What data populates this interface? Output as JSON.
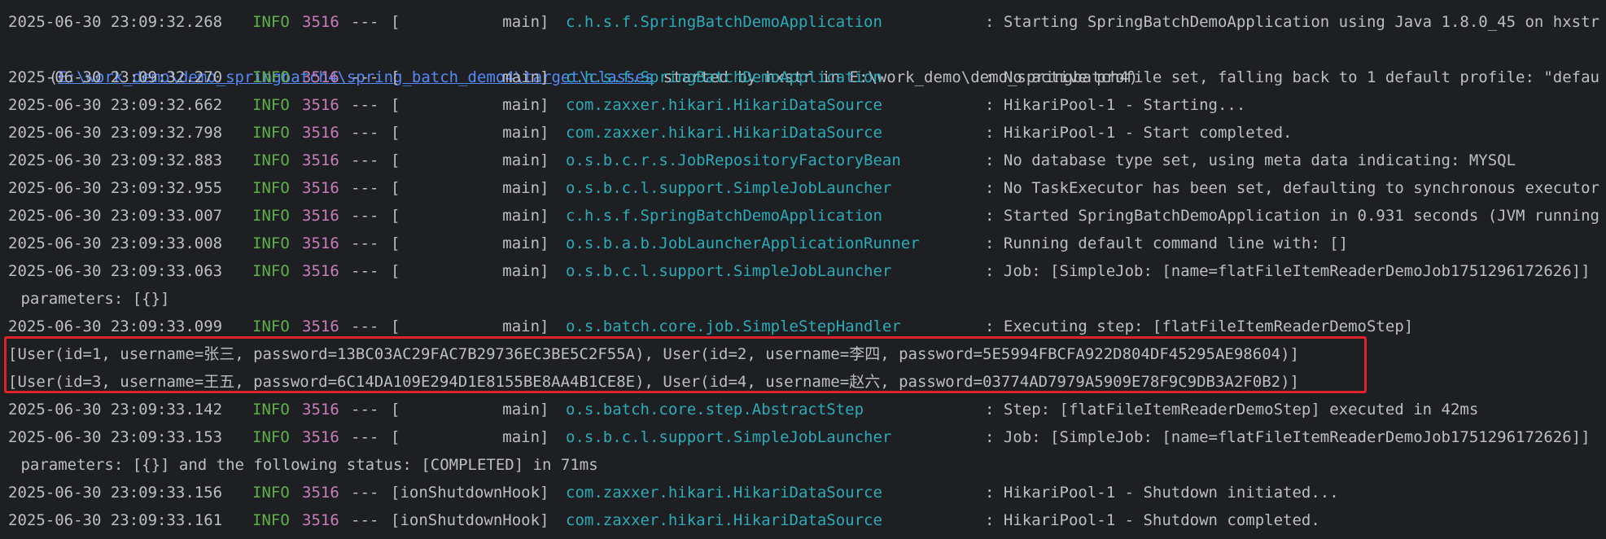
{
  "log": {
    "rows": [
      {
        "ts": "2025-06-30 23:09:32.268",
        "level": "INFO",
        "pid": "3516",
        "sep": "---",
        "thread": "[           main]",
        "logger": "c.h.s.f.SpringBatchDemoApplication",
        "msg": ": Starting SpringBatchDemoApplication using Java 1.8.0_45 on hxstr"
      },
      {
        "ts": "2025-06-30 23:09:32.270",
        "level": "INFO",
        "pid": "3516",
        "sep": "---",
        "thread": "[           main]",
        "logger": "c.h.s.f.SpringBatchDemoApplication",
        "msg": ": No active profile set, falling back to 1 default profile: \"defau"
      },
      {
        "ts": "2025-06-30 23:09:32.662",
        "level": "INFO",
        "pid": "3516",
        "sep": "---",
        "thread": "[           main]",
        "logger": "com.zaxxer.hikari.HikariDataSource",
        "msg": ": HikariPool-1 - Starting..."
      },
      {
        "ts": "2025-06-30 23:09:32.798",
        "level": "INFO",
        "pid": "3516",
        "sep": "---",
        "thread": "[           main]",
        "logger": "com.zaxxer.hikari.HikariDataSource",
        "msg": ": HikariPool-1 - Start completed."
      },
      {
        "ts": "2025-06-30 23:09:32.883",
        "level": "INFO",
        "pid": "3516",
        "sep": "---",
        "thread": "[           main]",
        "logger": "o.s.b.c.r.s.JobRepositoryFactoryBean",
        "msg": ": No database type set, using meta data indicating: MYSQL"
      },
      {
        "ts": "2025-06-30 23:09:32.955",
        "level": "INFO",
        "pid": "3516",
        "sep": "---",
        "thread": "[           main]",
        "logger": "o.s.b.c.l.support.SimpleJobLauncher",
        "msg": ": No TaskExecutor has been set, defaulting to synchronous executor"
      },
      {
        "ts": "2025-06-30 23:09:33.007",
        "level": "INFO",
        "pid": "3516",
        "sep": "---",
        "thread": "[           main]",
        "logger": "c.h.s.f.SpringBatchDemoApplication",
        "msg": ": Started SpringBatchDemoApplication in 0.931 seconds (JVM running"
      },
      {
        "ts": "2025-06-30 23:09:33.008",
        "level": "INFO",
        "pid": "3516",
        "sep": "---",
        "thread": "[           main]",
        "logger": "o.s.b.a.b.JobLauncherApplicationRunner",
        "msg": ": Running default command line with: []"
      },
      {
        "ts": "2025-06-30 23:09:33.063",
        "level": "INFO",
        "pid": "3516",
        "sep": "---",
        "thread": "[           main]",
        "logger": "o.s.b.c.l.support.SimpleJobLauncher",
        "msg": ": Job: [SimpleJob: [name=flatFileItemReaderDemoJob1751296172626]]"
      },
      {
        "ts": "2025-06-30 23:09:33.099",
        "level": "INFO",
        "pid": "3516",
        "sep": "---",
        "thread": "[           main]",
        "logger": "o.s.batch.core.job.SimpleStepHandler",
        "msg": ": Executing step: [flatFileItemReaderDemoStep]"
      },
      {
        "ts": "2025-06-30 23:09:33.142",
        "level": "INFO",
        "pid": "3516",
        "sep": "---",
        "thread": "[           main]",
        "logger": "o.s.batch.core.step.AbstractStep",
        "msg": ": Step: [flatFileItemReaderDemoStep] executed in 42ms"
      },
      {
        "ts": "2025-06-30 23:09:33.153",
        "level": "INFO",
        "pid": "3516",
        "sep": "---",
        "thread": "[           main]",
        "logger": "o.s.b.c.l.support.SimpleJobLauncher",
        "msg": ": Job: [SimpleJob: [name=flatFileItemReaderDemoJob1751296172626]]"
      },
      {
        "ts": "2025-06-30 23:09:33.156",
        "level": "INFO",
        "pid": "3516",
        "sep": "---",
        "thread": "[ionShutdownHook]",
        "logger": "com.zaxxer.hikari.HikariDataSource",
        "msg": ": HikariPool-1 - Shutdown initiated..."
      },
      {
        "ts": "2025-06-30 23:09:33.161",
        "level": "INFO",
        "pid": "3516",
        "sep": "---",
        "thread": "[ionShutdownHook]",
        "logger": "com.zaxxer.hikari.HikariDataSource",
        "msg": ": HikariPool-1 - Shutdown completed."
      }
    ],
    "continuation_1": {
      "open": "(",
      "path": "E:\\work_demo\\demo_springbatch4\\spring_batch_demo4\\target\\classes",
      "rest": " started by hxstr in E:\\work_demo\\demo_springbatch4)"
    },
    "continuation_2": " parameters: [{}]",
    "continuation_3": " parameters: [{}] and the following status: [COMPLETED] in 71ms",
    "output_lines": [
      "[User(id=1, username=张三, password=13BC03AC29FAC7B29736EC3BE5C2F55A), User(id=2, username=李四, password=5E5994FBCFA922D804DF45295AE98604)]",
      "[User(id=3, username=王五, password=6C14DA109E294D1E8155BE8AA4B1CE8E), User(id=4, username=赵六, password=03774AD7979A5909E78F9C9DB3A2F0B2)]"
    ]
  },
  "colors": {
    "background": "#1e1f22",
    "text": "#bcbec4",
    "info_level": "#5fb049",
    "pid": "#c77dbb",
    "logger": "#2aacb8",
    "link": "#548af7",
    "highlight_border": "#e0222a"
  }
}
